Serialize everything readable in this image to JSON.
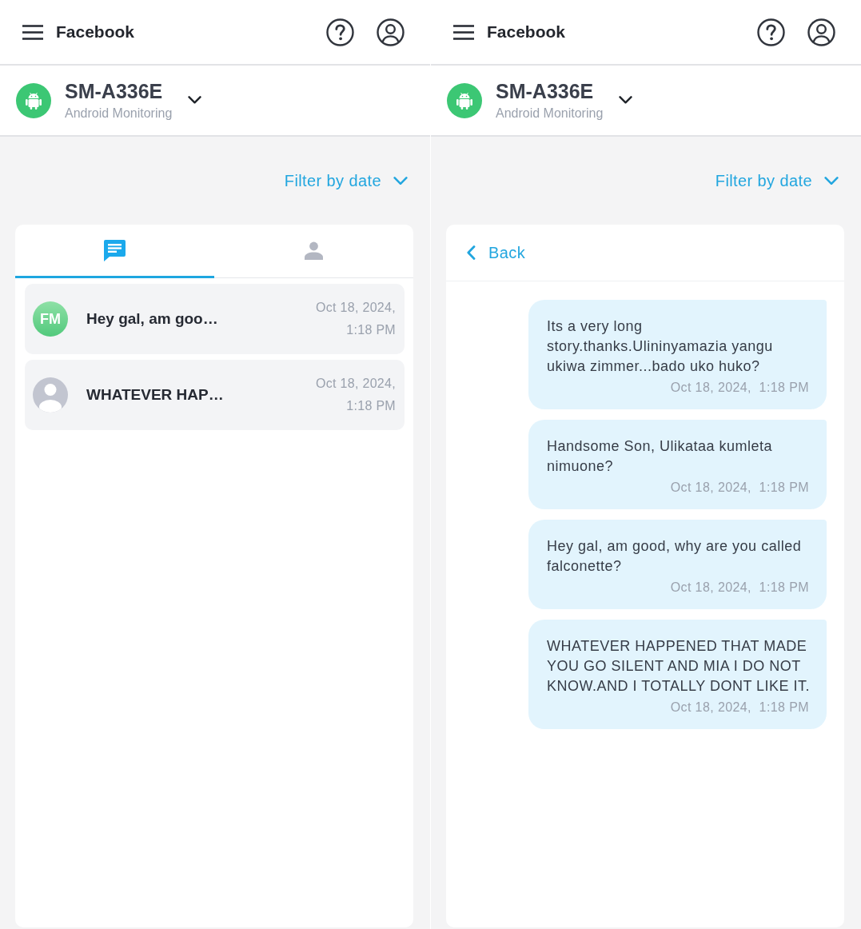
{
  "screens": [
    {
      "kind": "list",
      "app_bar": {
        "title": "Facebook"
      },
      "device": {
        "name": "SM-A336E",
        "subtitle": "Android Monitoring"
      },
      "filter": {
        "label": "Filter by date"
      },
      "tabs": [
        {
          "kind": "messages",
          "selected": true
        },
        {
          "kind": "contacts",
          "selected": false
        }
      ],
      "conversations": [
        {
          "avatar": {
            "kind": "initials",
            "initials": "FM"
          },
          "preview": "Hey gal, am goo…",
          "timestamp": "Oct 18, 2024, 1:18 PM"
        },
        {
          "avatar": {
            "kind": "silhouette"
          },
          "preview": "WHATEVER HAP…",
          "timestamp": "Oct 18, 2024, 1:18 PM"
        }
      ]
    },
    {
      "kind": "thread",
      "app_bar": {
        "title": "Facebook"
      },
      "device": {
        "name": "SM-A336E",
        "subtitle": "Android Monitoring"
      },
      "filter": {
        "label": "Filter by date"
      },
      "back": {
        "label": "Back"
      },
      "messages": [
        {
          "text": "Its a very long story.thanks.Ulininyamazia yangu ukiwa zimmer...bado uko huko?",
          "timestamp": "Oct 18, 2024,  1:18 PM"
        },
        {
          "text": "Handsome Son, Ulikataa kumleta nimuone?",
          "timestamp": "Oct 18, 2024,  1:18 PM"
        },
        {
          "text": "Hey gal, am good, why are you called falconette?",
          "timestamp": "Oct 18, 2024,  1:18 PM"
        },
        {
          "text": "WHATEVER HAPPENED THAT MADE YOU GO SILENT AND MIA I DO NOT KNOW.AND I TOTALLY DONT LIKE IT.",
          "timestamp": "Oct 18, 2024,  1:18 PM"
        }
      ]
    }
  ]
}
